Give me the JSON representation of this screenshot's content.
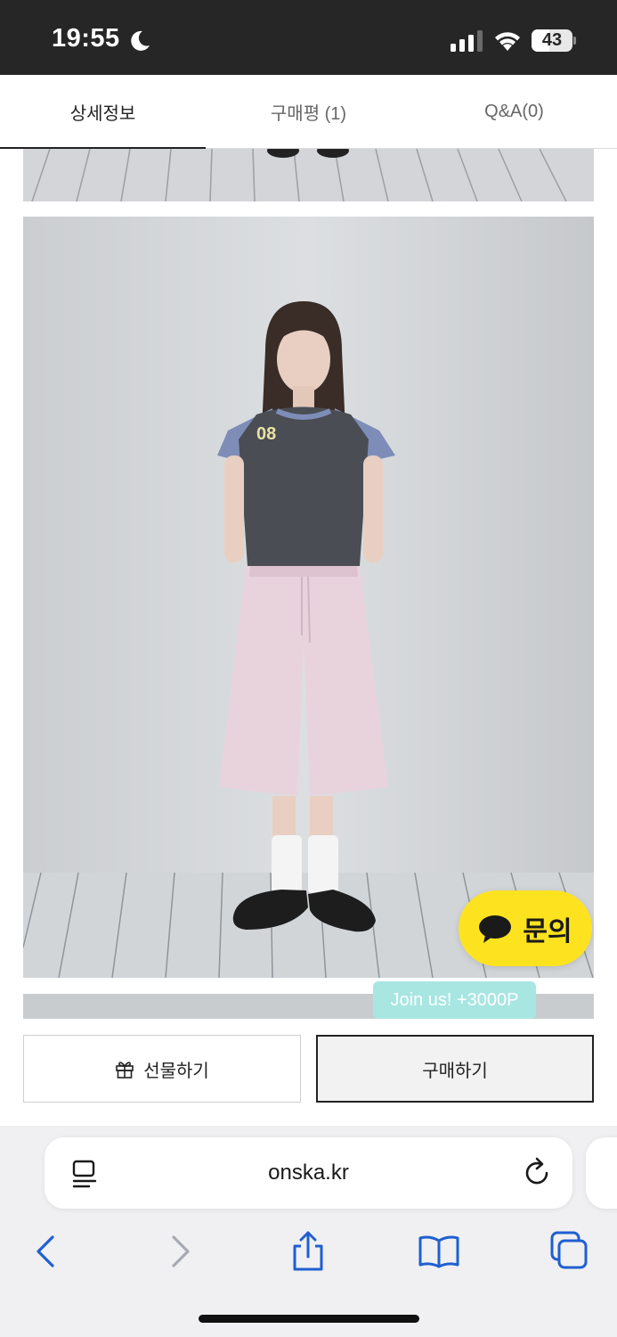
{
  "status_bar": {
    "time": "19:55",
    "battery_level": "43",
    "icons": [
      "moon-icon",
      "cellular-signal-icon",
      "wifi-icon",
      "battery-icon"
    ]
  },
  "tabs": [
    {
      "label": "상세정보",
      "active": true
    },
    {
      "label": "구매평 (1)",
      "active": false
    },
    {
      "label": "Q&A(0)",
      "active": false
    }
  ],
  "product_photo": {
    "shirt_number": "08"
  },
  "floating": {
    "inquiry_label": "문의",
    "inquiry_color": "#fde31f",
    "join_badge": "Join us! +3000P",
    "join_badge_color": "#a8e6e2"
  },
  "actions": {
    "gift_label": "선물하기",
    "buy_label": "구매하기"
  },
  "browser": {
    "address": "onska.kr",
    "accent": "#1f5fd1",
    "toolbar_icons": [
      "back-icon",
      "forward-icon",
      "share-icon",
      "bookmarks-icon",
      "tabs-icon"
    ]
  }
}
